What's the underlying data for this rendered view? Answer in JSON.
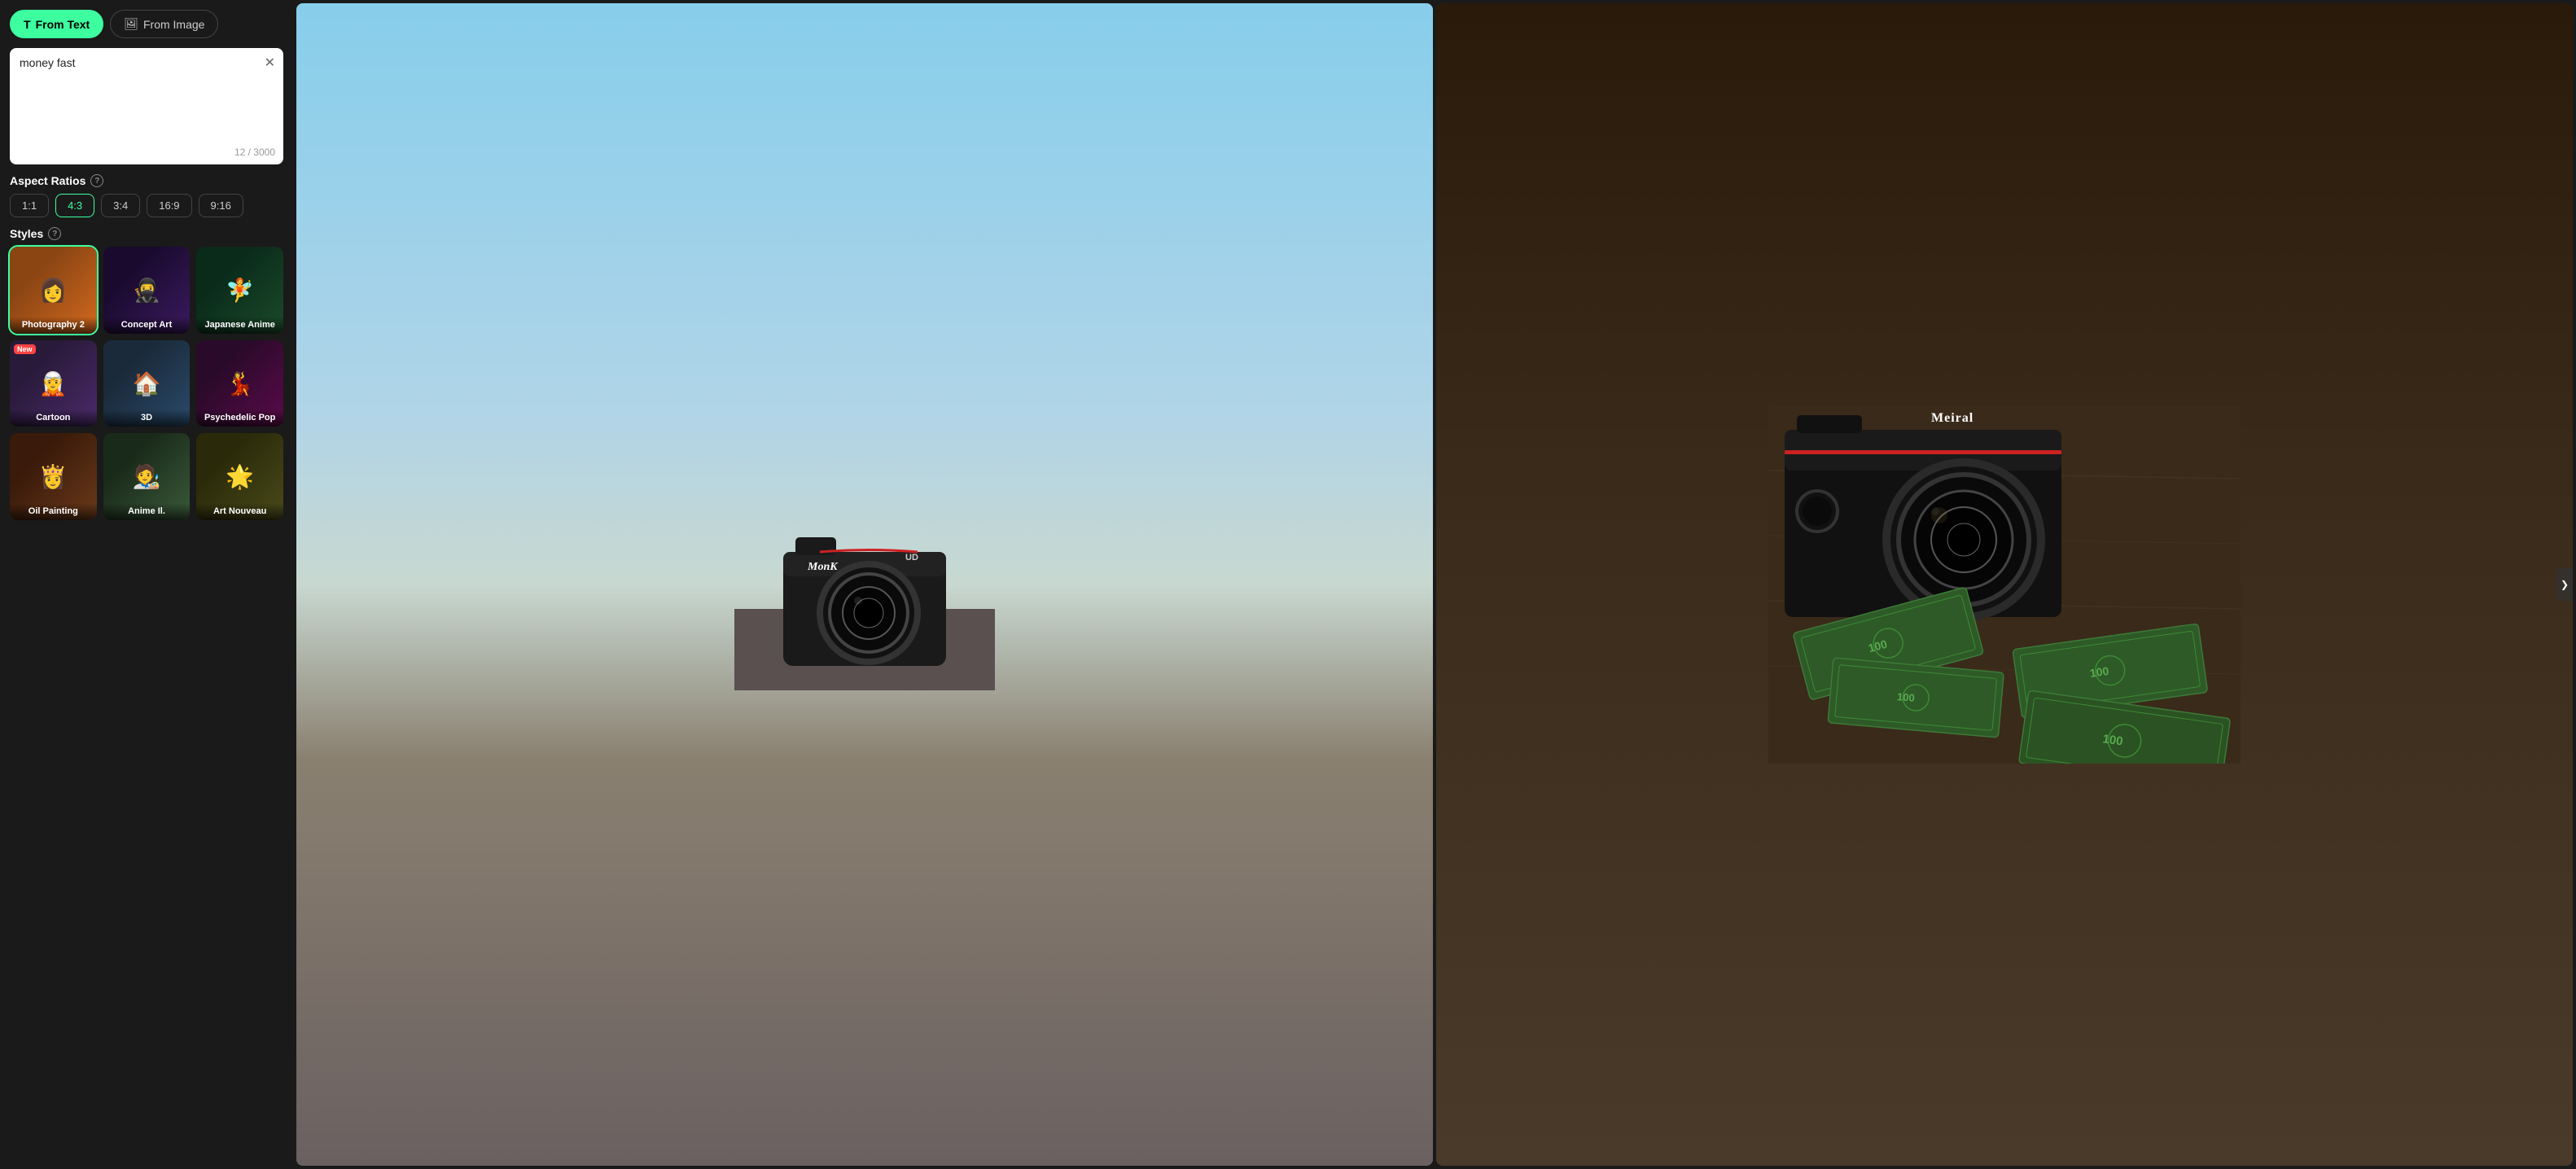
{
  "tabs": {
    "from_text": {
      "label": "From Text",
      "icon": "T",
      "active": true
    },
    "from_image": {
      "label": "From Image",
      "icon": "🖼",
      "active": false
    }
  },
  "text_input": {
    "value": "money fast",
    "char_count": "12",
    "max_chars": "3000",
    "char_display": "12 / 3000"
  },
  "aspect_ratios": {
    "label": "Aspect Ratios",
    "options": [
      "1:1",
      "4:3",
      "3:4",
      "16:9",
      "9:16"
    ],
    "active": "4:3"
  },
  "styles": {
    "label": "Styles",
    "items": [
      {
        "id": "photography2",
        "label": "Photography 2",
        "active": true,
        "new": false,
        "thumb_class": "thumb-photo2"
      },
      {
        "id": "concept-art",
        "label": "Concept Art",
        "active": false,
        "new": false,
        "thumb_class": "thumb-concept"
      },
      {
        "id": "japanese-anime",
        "label": "Japanese Anime",
        "active": false,
        "new": false,
        "thumb_class": "thumb-anime"
      },
      {
        "id": "cartoon",
        "label": "Cartoon",
        "active": false,
        "new": true,
        "thumb_class": "thumb-cartoon"
      },
      {
        "id": "3d",
        "label": "3D",
        "active": false,
        "new": false,
        "thumb_class": "thumb-3d"
      },
      {
        "id": "psychedelic-pop",
        "label": "Psychedelic Pop",
        "active": false,
        "new": false,
        "thumb_class": "thumb-psychedelic"
      },
      {
        "id": "oil-painting",
        "label": "Oil Painting",
        "active": false,
        "new": false,
        "thumb_class": "thumb-oil"
      },
      {
        "id": "anime-il",
        "label": "Anime Il.",
        "active": false,
        "new": false,
        "thumb_class": "thumb-animeil"
      },
      {
        "id": "art-nouveau",
        "label": "Art Nouveau",
        "active": false,
        "new": false,
        "thumb_class": "thumb-artnouveau"
      }
    ],
    "new_label": "New"
  },
  "images": {
    "left": {
      "alt": "DSLR camera on beach/asphalt",
      "label": "MonK UD camera"
    },
    "right": {
      "alt": "Meiral camera with money bills",
      "label": "Meiral camera with dollar bills"
    }
  },
  "scroll_arrow": "❯"
}
